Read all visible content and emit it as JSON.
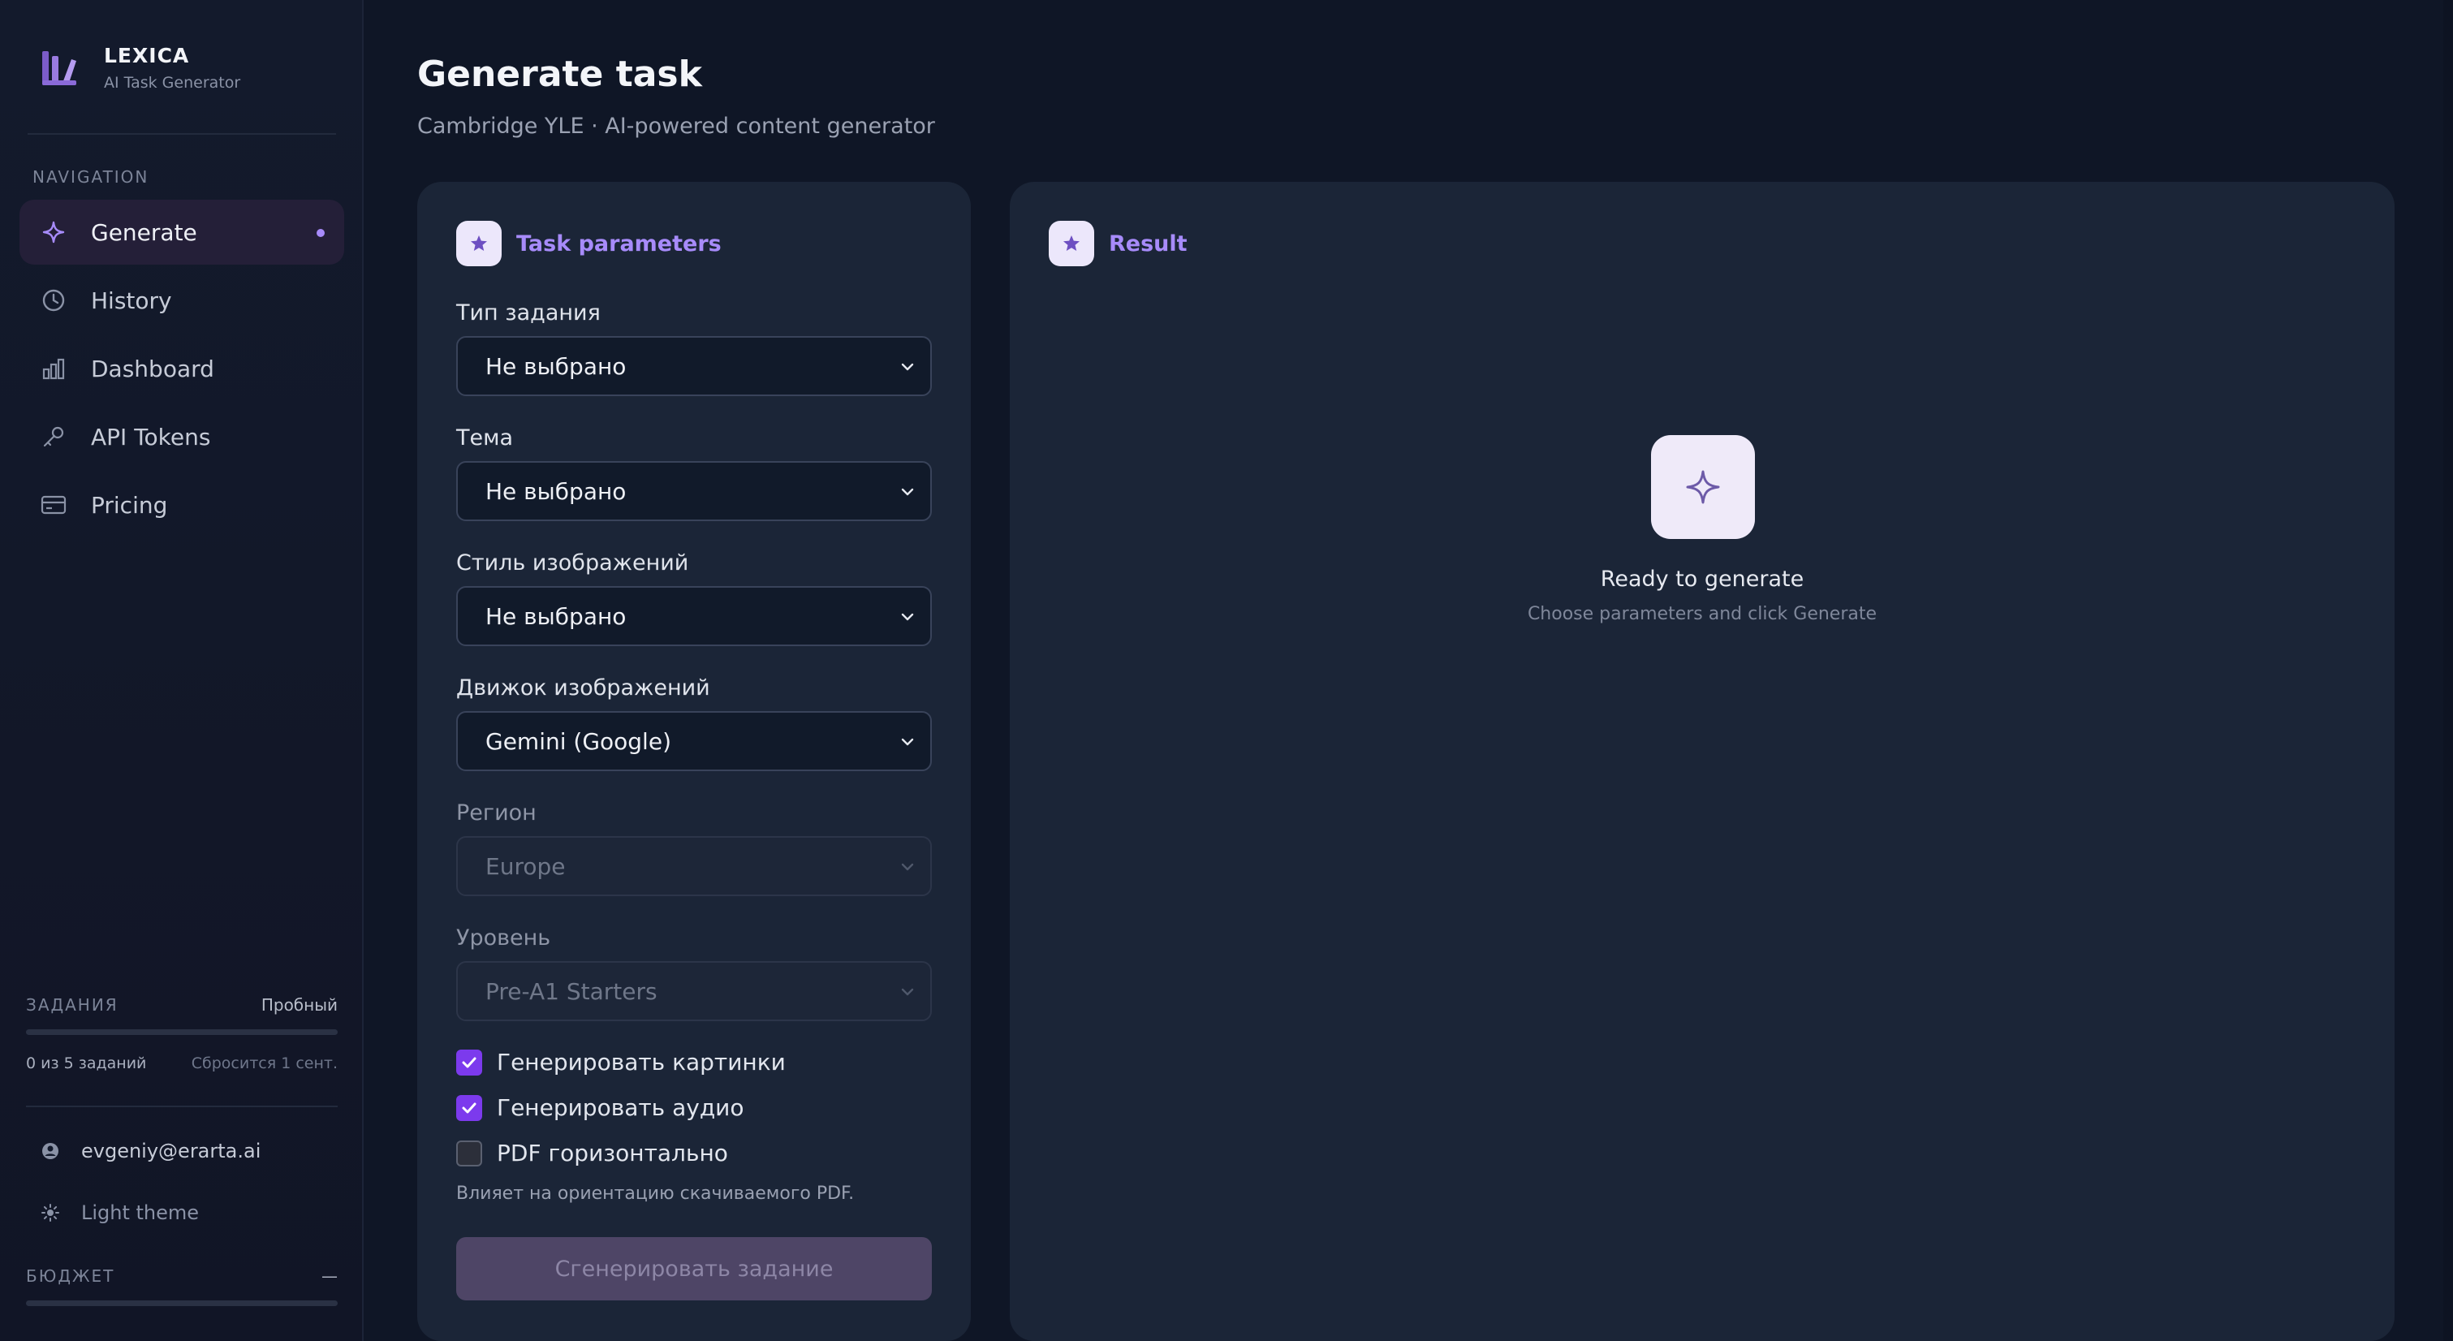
{
  "brand": {
    "name": "LEXICA",
    "subtitle": "AI Task Generator"
  },
  "nav": {
    "title": "NAVIGATION",
    "items": [
      {
        "label": "Generate",
        "icon": "sparkle-icon",
        "active": true
      },
      {
        "label": "History",
        "icon": "clock-icon"
      },
      {
        "label": "Dashboard",
        "icon": "bar-chart-icon"
      },
      {
        "label": "API Tokens",
        "icon": "key-icon"
      },
      {
        "label": "Pricing",
        "icon": "card-icon"
      }
    ]
  },
  "quota": {
    "label": "ЗАДАНИЯ",
    "plan": "Пробный",
    "count": "0 из 5 заданий",
    "reset": "Сбросится 1 сент.",
    "progress": 0
  },
  "user": {
    "email": "evgeniy@erarta.ai",
    "icon": "user-icon"
  },
  "theme": {
    "label": "Light theme",
    "icon": "sun-icon"
  },
  "budget": {
    "label": "БЮДЖЕТ",
    "value": "—",
    "progress": 0
  },
  "page": {
    "title": "Generate task",
    "subtitle": "Cambridge YLE · AI-powered content generator"
  },
  "params": {
    "title": "Task parameters",
    "fields": [
      {
        "label": "Тип задания",
        "value": "Не выбрано",
        "disabled": false
      },
      {
        "label": "Тема",
        "value": "Не выбрано",
        "disabled": false
      },
      {
        "label": "Стиль изображений",
        "value": "Не выбрано",
        "disabled": false
      },
      {
        "label": "Движок изображений",
        "value": "Gemini (Google)",
        "disabled": false
      },
      {
        "label": "Регион",
        "value": "Europe",
        "disabled": true
      },
      {
        "label": "Уровень",
        "value": "Pre-A1 Starters",
        "disabled": true
      }
    ],
    "checkboxes": [
      {
        "label": "Генерировать картинки",
        "checked": true
      },
      {
        "label": "Генерировать аудио",
        "checked": true
      },
      {
        "label": "PDF горизонтально",
        "checked": false
      }
    ],
    "hint": "Влияет на ориентацию скачиваемого PDF.",
    "generate_label": "Сгенерировать задание"
  },
  "result": {
    "title": "Result",
    "empty_title": "Ready to generate",
    "empty_subtitle": "Choose parameters and click Generate"
  },
  "colors": {
    "accent": "#a78bfa",
    "background": "#0f1626",
    "panel": "#1b2537",
    "checkbox": "#7c3aed"
  }
}
